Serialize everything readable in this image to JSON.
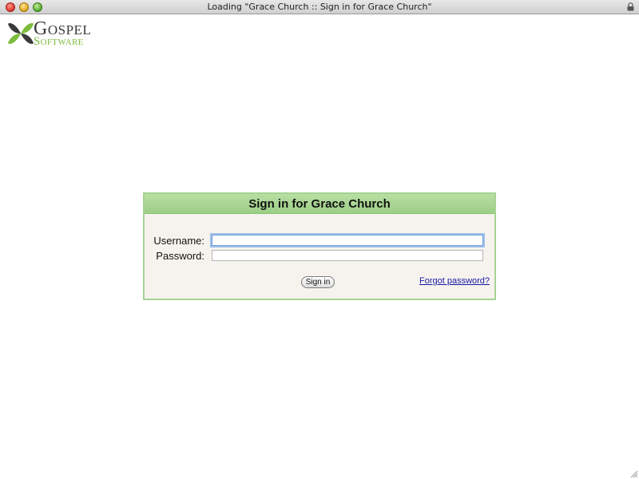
{
  "window": {
    "title": "Loading \"Grace Church :: Sign in for Grace Church\""
  },
  "logo": {
    "line1": "Gospel",
    "line2": "Software",
    "colors": {
      "leaf_dark": "#3a3a3a",
      "leaf_green": "#7cbc3c"
    }
  },
  "signin": {
    "heading": "Sign in for Grace Church",
    "username_label": "Username:",
    "username_value": "",
    "password_label": "Password:",
    "password_value": "",
    "button_label": "Sign in",
    "forgot_link": "Forgot password?"
  },
  "colors": {
    "panel_border": "#a6d393",
    "panel_header": "#9ccf86",
    "panel_bg": "#f6f3ee",
    "link": "#1a1aa6"
  }
}
